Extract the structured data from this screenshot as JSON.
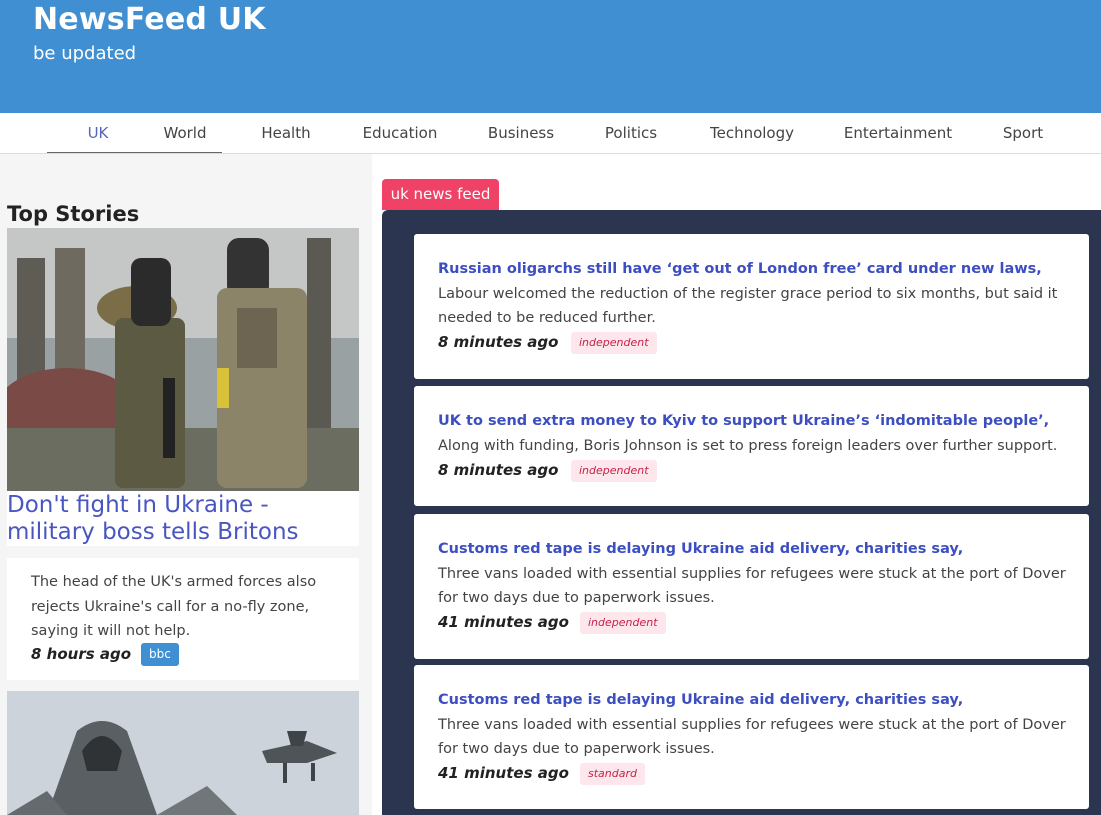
{
  "header": {
    "title": "NewsFeed UK",
    "subtitle": "be updated"
  },
  "nav": {
    "tabs": [
      {
        "label": "UK"
      },
      {
        "label": "World"
      },
      {
        "label": "Health"
      },
      {
        "label": "Education"
      },
      {
        "label": "Business"
      },
      {
        "label": "Politics"
      },
      {
        "label": "Technology"
      },
      {
        "label": "Entertainment"
      },
      {
        "label": "Sport"
      }
    ],
    "active": "UK"
  },
  "top_stories": {
    "heading": "Top Stories",
    "items": [
      {
        "title": "Don't fight in Ukraine - military boss tells Britons",
        "description": "The head of the UK's armed forces also rejects Ukraine's call for a no-fly zone, saying it will not help.",
        "time": "8 hours ago",
        "source": "bbc"
      }
    ]
  },
  "feed": {
    "tag": "uk news feed",
    "items": [
      {
        "title": "Russian oligarchs still have ‘get out of London free’ card under new laws,",
        "description": "Labour welcomed the reduction of the register grace period to six months, but said it needed to be reduced further.",
        "time": "8 minutes ago",
        "source": "independent"
      },
      {
        "title": "UK to send extra money to Kyiv to support Ukraine’s ‘indomitable people’,",
        "description": "Along with funding, Boris Johnson is set to press foreign leaders over further support.",
        "time": "8 minutes ago",
        "source": "independent"
      },
      {
        "title": "Customs red tape is delaying Ukraine aid delivery, charities say,",
        "description": "Three vans loaded with essential supplies for refugees were stuck at the port of Dover for two days due to paperwork issues.",
        "time": "41 minutes ago",
        "source": "independent"
      },
      {
        "title": "Customs red tape is delaying Ukraine aid delivery, charities say,",
        "description": "Three vans loaded with essential supplies for refugees were stuck at the port of Dover for two days due to paperwork issues.",
        "time": "41 minutes ago",
        "source": "standard"
      }
    ]
  },
  "colors": {
    "header": "#3f8fd2",
    "accent_link": "#3d4fc0",
    "feed_panel": "#2c3550",
    "feed_tag": "#ef4266",
    "badge_bg": "#fde7ec",
    "badge_text": "#c6234a"
  }
}
